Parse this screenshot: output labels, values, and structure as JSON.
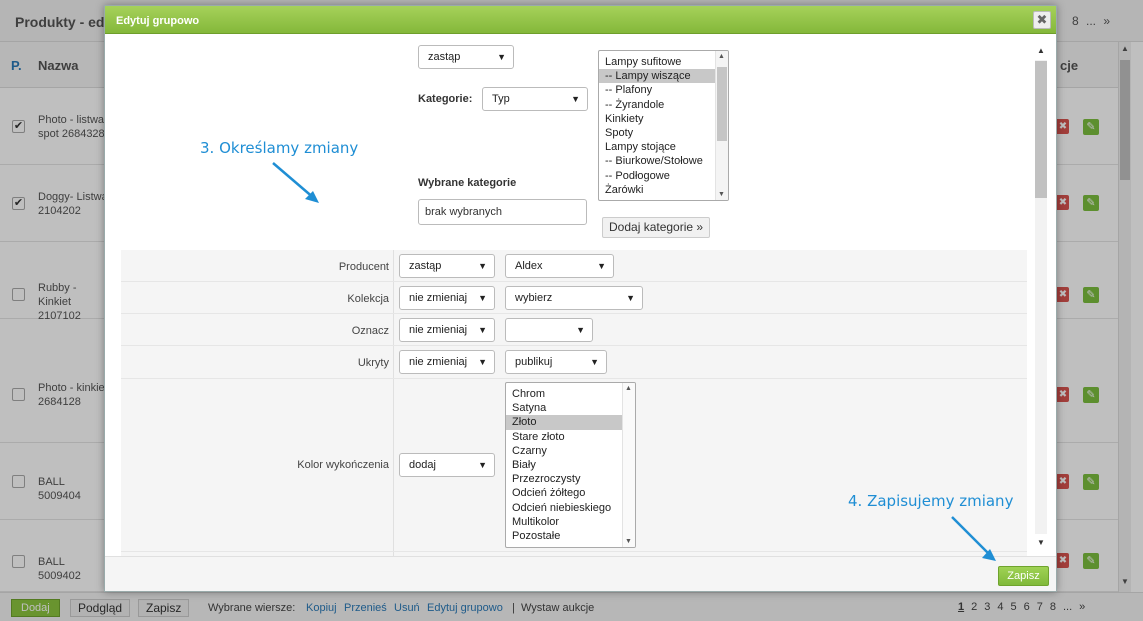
{
  "page": {
    "title": "Produkty - ed",
    "pager_top": "8 ... »",
    "col_p": "P.",
    "col_name": "Nazwa",
    "col_actions": "cje"
  },
  "rows": [
    {
      "name": "Photo - listwa spot 2684328",
      "checked": true,
      "check": "✔"
    },
    {
      "name": "Doggy- Listwa 2104202",
      "checked": true,
      "check": "✔"
    },
    {
      "name": "Rubby - Kinkiet 2107102",
      "checked": false,
      "check": ""
    },
    {
      "name": "Photo - kinkiet 2684128",
      "checked": false,
      "check": ""
    },
    {
      "name": "BALL 5009404",
      "checked": false,
      "check": ""
    },
    {
      "name": "BALL 5009402",
      "checked": false,
      "check": ""
    }
  ],
  "footer": {
    "add": "Dodaj",
    "preview": "Podgląd",
    "save": "Zapisz",
    "selected_rows": "Wybrane wiersze:",
    "copy": "Kopiuj",
    "move": "Przenieś",
    "delete": "Usuń",
    "group_edit": "Edytuj grupowo",
    "separator": "|",
    "auction": "Wystaw aukcje",
    "pages": [
      "1",
      "2",
      "3",
      "4",
      "5",
      "6",
      "7",
      "8",
      "...",
      "»"
    ]
  },
  "modal": {
    "title": "Edytuj grupowo",
    "close": "✖",
    "save": "Zapisz",
    "category_mode": "zastąp",
    "category_label": "Kategorie:",
    "category_type": "Typ",
    "categories": [
      "Lampy sufitowe",
      "-- Lampy wiszące",
      "-- Plafony",
      "-- Żyrandole",
      "Kinkiety",
      "Spoty",
      "Lampy stojące",
      "-- Biurkowe/Stołowe",
      "-- Podłogowe",
      "Żarówki"
    ],
    "selected_categories_label": "Wybrane kategorie",
    "selected_categories_value": "brak wybranych",
    "add_categories": "Dodaj kategorie »",
    "fields": [
      {
        "label": "Producent",
        "mode": "zastąp",
        "value": "Aldex"
      },
      {
        "label": "Kolekcja",
        "mode": "nie zmieniaj",
        "value": "wybierz"
      },
      {
        "label": "Oznacz",
        "mode": "nie zmieniaj",
        "value": ""
      },
      {
        "label": "Ukryty",
        "mode": "nie zmieniaj",
        "value": "publikuj"
      },
      {
        "label": "Kolor wykończenia",
        "mode": "dodaj",
        "value": ""
      }
    ],
    "colors": [
      "Chrom",
      "Satyna",
      "Złoto",
      "Stare złoto",
      "Czarny",
      "Biały",
      "Przezroczysty",
      "Odcień żółtego",
      "Odcień niebieskiego",
      "Multikolor",
      "Pozostałe"
    ]
  },
  "annotations": {
    "step3": "3. Określamy zmiany",
    "step4": "4. Zapisujemy zmiany"
  },
  "colors": {
    "accent_green": "#8cc63f",
    "link_blue": "#2a7ab8",
    "annotation_blue": "#1f8ed4",
    "delete_red": "#d9534f"
  }
}
